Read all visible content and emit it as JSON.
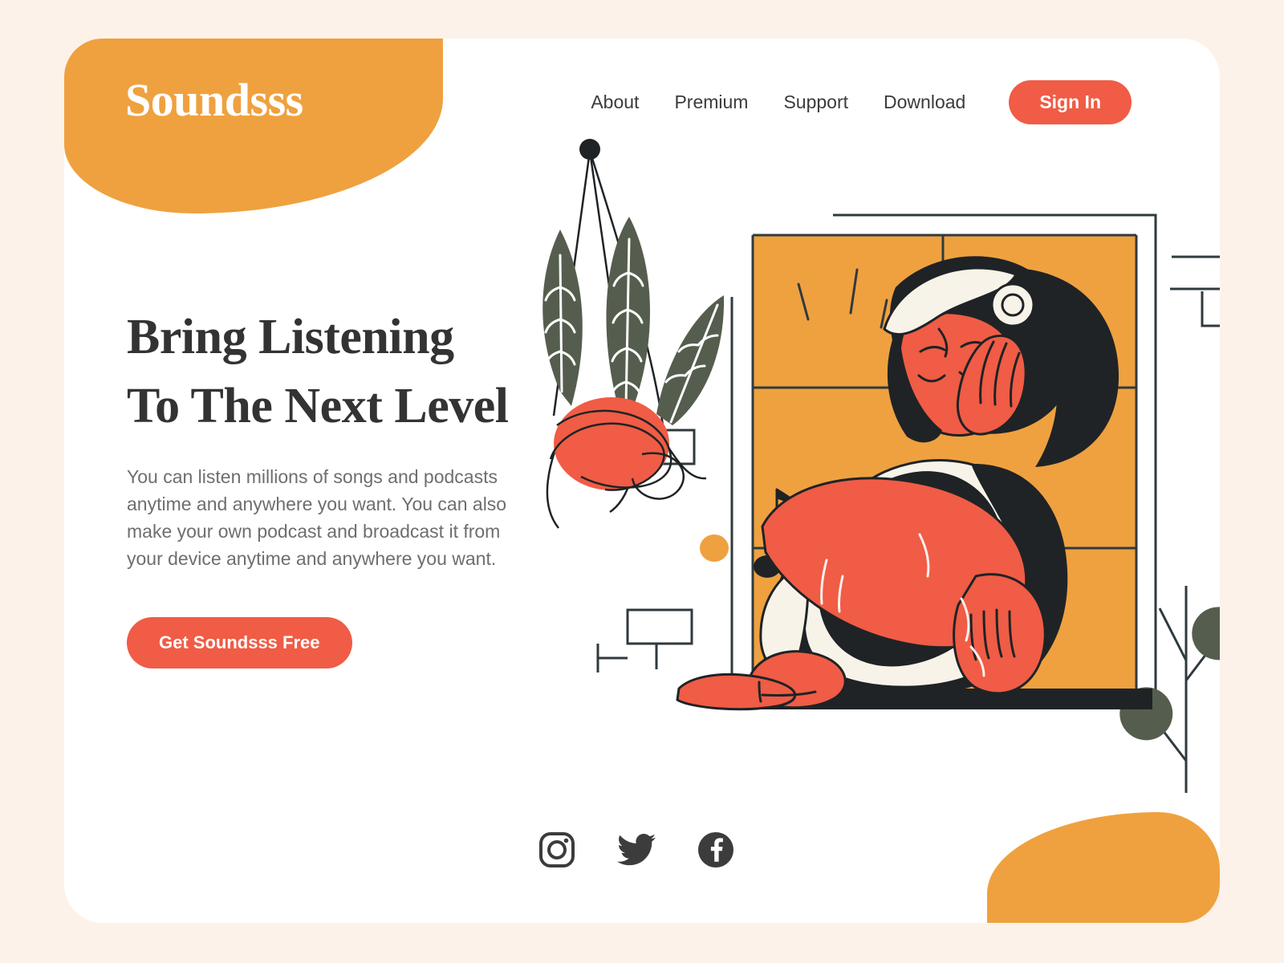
{
  "brand": {
    "name": "Soundsss"
  },
  "nav": {
    "links": [
      {
        "label": "About"
      },
      {
        "label": "Premium"
      },
      {
        "label": "Support"
      },
      {
        "label": "Download"
      }
    ],
    "signin_label": "Sign In"
  },
  "hero": {
    "headline_line1": "Bring Listening",
    "headline_line2": "To The Next Level",
    "paragraph": "You can listen millions of songs and podcasts anytime and anywhere you want. You can also make your own podcast and broadcast it from your device anytime and anywhere you want.",
    "cta_label": "Get Soundsss Free"
  },
  "socials": [
    {
      "name": "instagram"
    },
    {
      "name": "twitter"
    },
    {
      "name": "facebook"
    }
  ],
  "colors": {
    "page_background": "#FDF2E9",
    "card_background": "#FFFFFF",
    "brand_orange": "#EFA13F",
    "accent_red": "#F05C45",
    "ink": "#2B2B2B",
    "leaf_green": "#555E4E",
    "cream": "#F7F3E8",
    "text_muted": "#6E6E6E"
  },
  "illustration": {
    "description": "Woman with headphones sitting against an orange window, hanging plant, music note, decorative line shapes and leaves"
  }
}
